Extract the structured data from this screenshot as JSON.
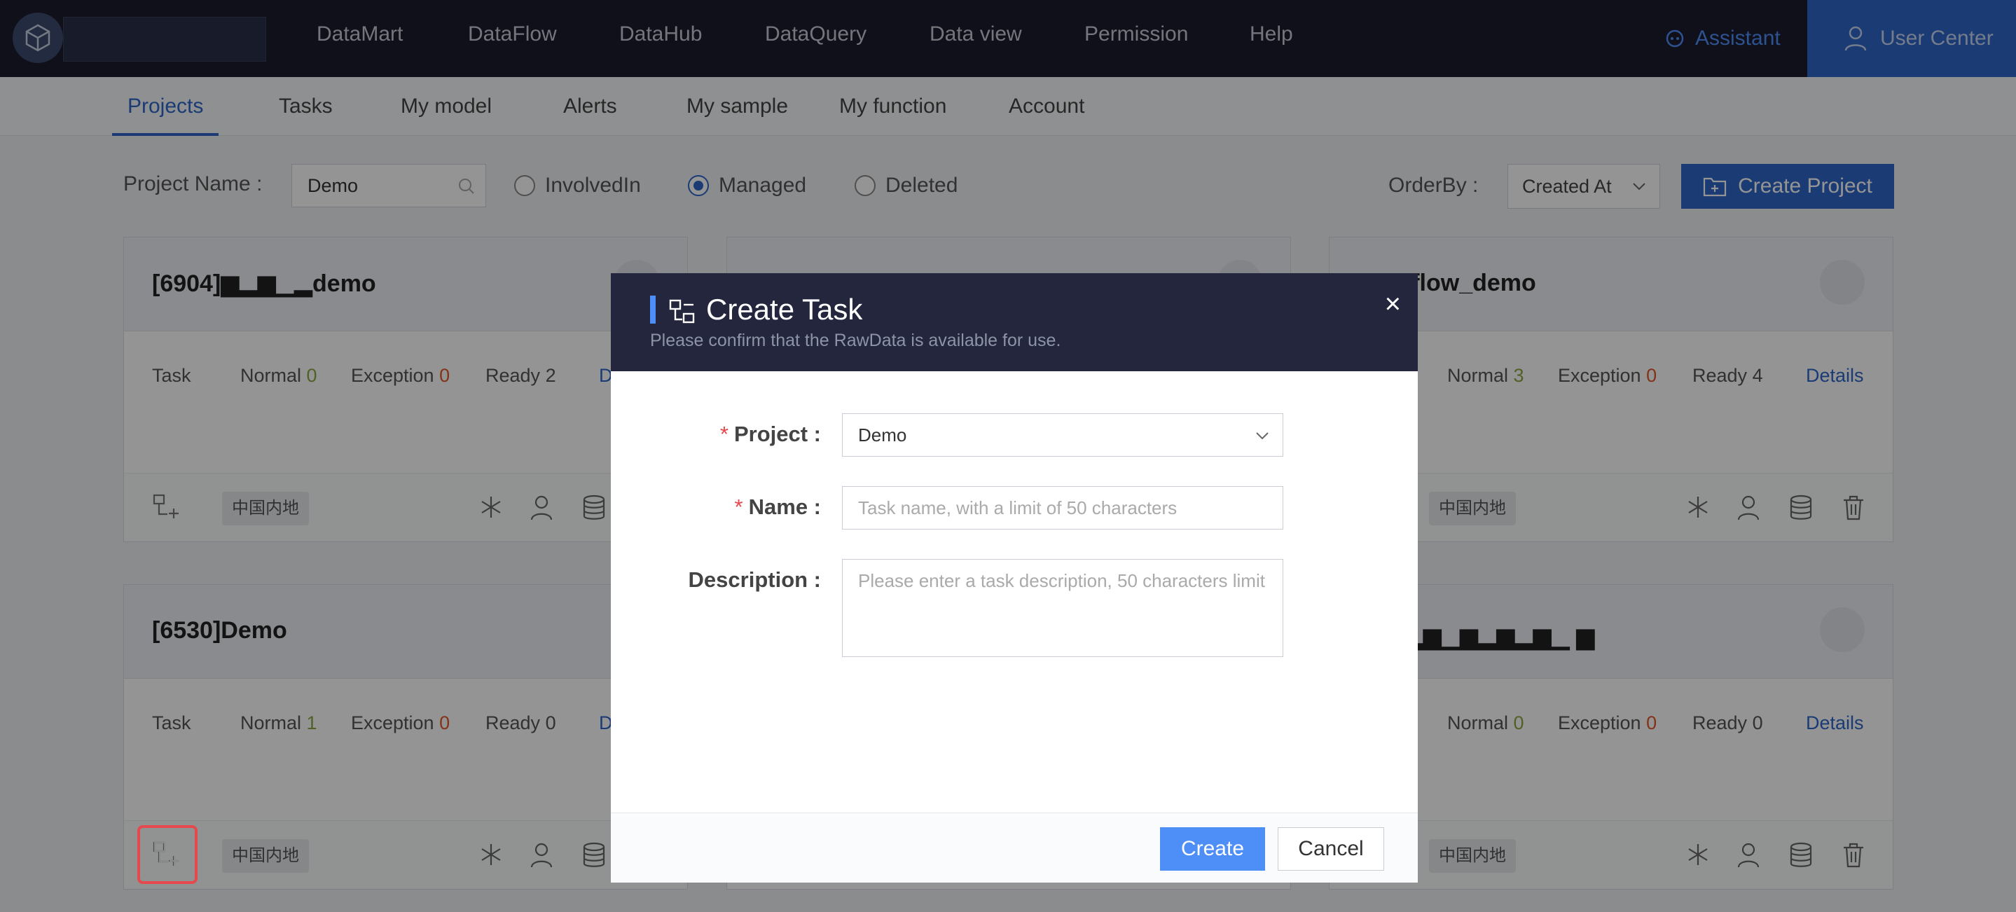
{
  "nav": {
    "items": [
      "DataMart",
      "DataFlow",
      "DataHub",
      "DataQuery",
      "Data view",
      "Permission",
      "Help"
    ],
    "assistant": "Assistant",
    "user_center": "User Center"
  },
  "subtabs": {
    "items": [
      "Projects",
      "Tasks",
      "My model",
      "Alerts",
      "My sample",
      "My function",
      "Account"
    ],
    "active": "Projects"
  },
  "filter": {
    "project_name_label": "Project Name :",
    "project_name_value": "Demo",
    "radios": [
      "InvolvedIn",
      "Managed",
      "Deleted"
    ],
    "selected_radio": "Managed",
    "orderby_label": "OrderBy :",
    "orderby_value": "Created At",
    "create_project": "Create Project"
  },
  "cards": [
    {
      "title": "[6904]▆▂▆▁▂demo",
      "task": "Task",
      "normal_label": "Normal",
      "normal": "0",
      "exception_label": "Exception",
      "exception": "0",
      "ready_label": "Ready",
      "ready": "2",
      "details": "D",
      "region": "中国内地"
    },
    {
      "title": "]dataflow_demo",
      "task": "",
      "normal_label": "Normal",
      "normal": "3",
      "exception_label": "Exception",
      "exception": "0",
      "ready_label": "Ready",
      "ready": "4",
      "details": "Details",
      "region": "中国内地"
    },
    {
      "title": "[6530]Demo",
      "task": "Task",
      "normal_label": "Normal",
      "normal": "1",
      "exception_label": "Exception",
      "exception": "0",
      "ready_label": "Ready",
      "ready": "0",
      "details": "D",
      "region": "中国内地"
    },
    {
      "title": "]指▆▂▆▁▆▂▆▂▆▁ ▆",
      "task": "",
      "normal_label": "Normal",
      "normal": "0",
      "exception_label": "Exception",
      "exception": "0",
      "ready_label": "Ready",
      "ready": "0",
      "details": "Details",
      "region": "中国内地"
    }
  ],
  "modal": {
    "title": "Create Task",
    "subtitle": "Please confirm that the RawData is available for use.",
    "close": "×",
    "project_label": "Project :",
    "project_value": "Demo",
    "name_label": "Name :",
    "name_placeholder": "Task name, with a limit of 50 characters",
    "description_label": "Description :",
    "description_placeholder": "Please enter a task description, 50 characters limit",
    "required_mark": "*",
    "create": "Create",
    "cancel": "Cancel"
  },
  "colors": {
    "accent": "#2f66c8",
    "modal_header": "#23263c",
    "create_button": "#4e8ef7",
    "normal_count": "#8aa845",
    "exception_count": "#e05a2b",
    "highlight": "#e5484d"
  }
}
